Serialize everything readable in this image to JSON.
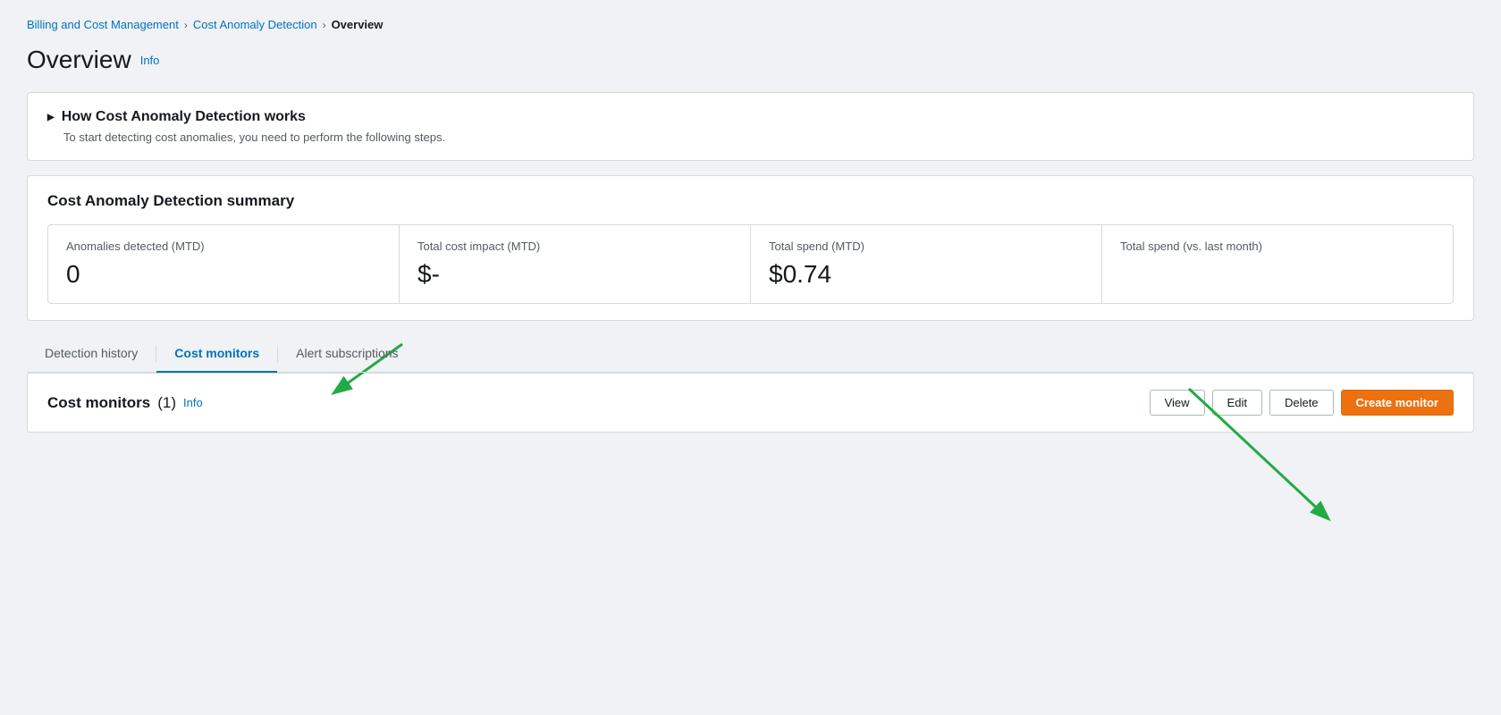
{
  "breadcrumb": {
    "billing": "Billing and Cost Management",
    "detection": "Cost Anomaly Detection",
    "current": "Overview"
  },
  "page": {
    "title": "Overview",
    "info_label": "Info"
  },
  "how_it_works": {
    "title": "How Cost Anomaly Detection works",
    "description": "To start detecting cost anomalies, you need to perform the following steps."
  },
  "summary": {
    "title": "Cost Anomaly Detection summary",
    "metrics": [
      {
        "label": "Anomalies detected (MTD)",
        "value": "0"
      },
      {
        "label": "Total cost impact (MTD)",
        "value": "$-"
      },
      {
        "label": "Total spend (MTD)",
        "value": "$0.74"
      },
      {
        "label": "Total spend (vs. last month)",
        "value": ""
      }
    ]
  },
  "tabs": [
    {
      "id": "detection-history",
      "label": "Detection history",
      "active": false
    },
    {
      "id": "cost-monitors",
      "label": "Cost monitors",
      "active": true
    },
    {
      "id": "alert-subscriptions",
      "label": "Alert subscriptions",
      "active": false
    }
  ],
  "cost_monitors": {
    "title": "Cost monitors",
    "count": "(1)",
    "info_label": "Info",
    "buttons": {
      "view": "View",
      "edit": "Edit",
      "delete": "Delete",
      "create": "Create monitor"
    }
  }
}
